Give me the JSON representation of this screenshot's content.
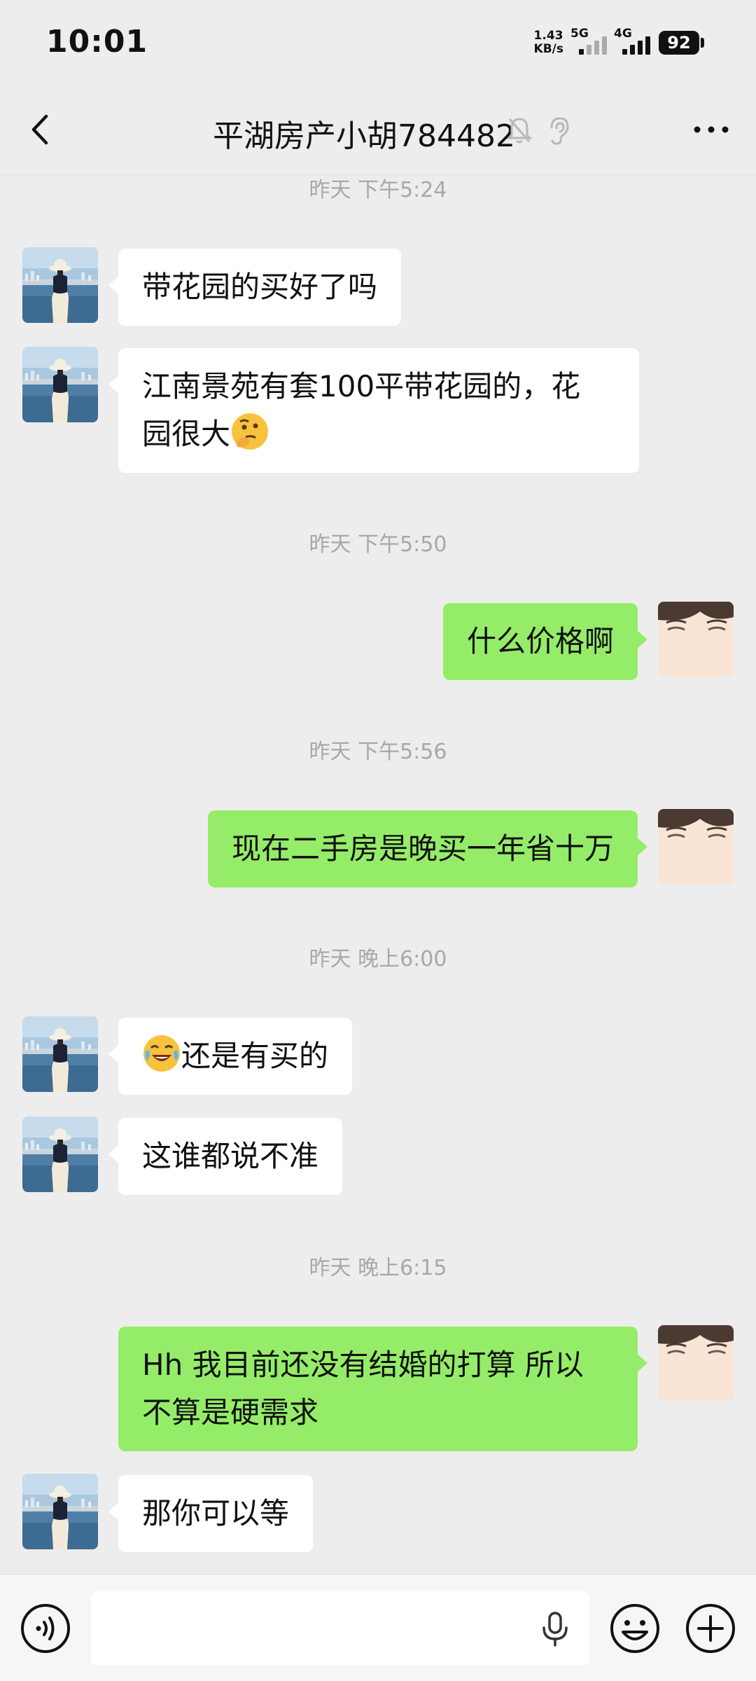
{
  "status_bar": {
    "time": "10:01",
    "net_speed_value": "1.43",
    "net_speed_unit": "KB/s",
    "signal_1_label": "5G",
    "signal_2_label": "4G",
    "battery": "92"
  },
  "header": {
    "title": "平湖房产小胡784482"
  },
  "messages": {
    "ts1": "昨天 下午5:24",
    "m1": "带花园的买好了吗",
    "m2_line1": "江南景苑有套100平带花园的，花",
    "m2_line2": "园很大",
    "ts2": "昨天 下午5:50",
    "m3": "什么价格啊",
    "ts3": "昨天 下午5:56",
    "m4": "现在二手房是晚买一年省十万",
    "ts4": "昨天 晚上6:00",
    "m5": "还是有买的",
    "m6": "这谁都说不准",
    "ts5": "昨天 晚上6:15",
    "m7_line1": "Hh 我目前还没有结婚的打算 所以",
    "m7_line2": "不算是硬需求",
    "m8": "那你可以等"
  },
  "input": {
    "value": ""
  },
  "colors": {
    "background": "#ededed",
    "bubble_self": "#95ec69",
    "bubble_other": "#ffffff",
    "timestamp": "#a8a8a8"
  },
  "icons": {
    "back": "back-arrow-icon",
    "mute": "bell-muted-icon",
    "earpiece": "ear-icon",
    "more": "more-dots-icon",
    "voice": "voice-icon",
    "mic": "microphone-icon",
    "emoji": "emoji-face-icon",
    "plus": "plus-icon"
  }
}
